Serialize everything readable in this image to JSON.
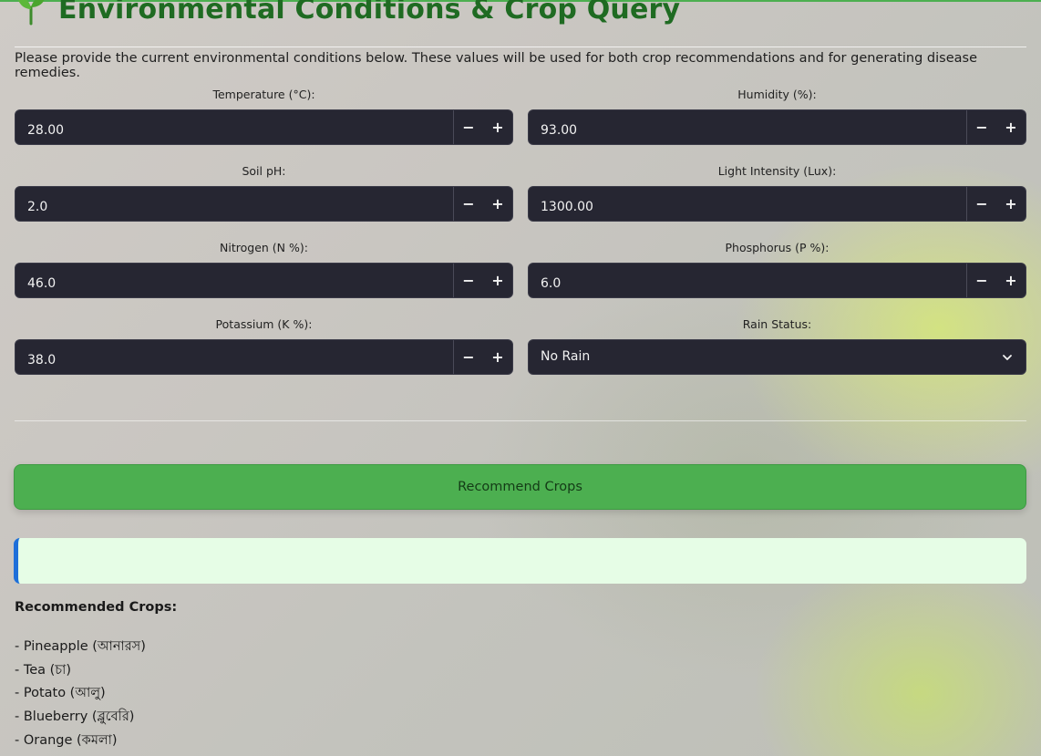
{
  "header": {
    "title": "Environmental Conditions & Crop Query",
    "icon": "sprout-icon"
  },
  "intro_text": "Please provide the current environmental conditions below. These values will be used for both crop recommendations and for generating disease remedies.",
  "fields": {
    "temperature": {
      "label": "Temperature (°C):",
      "value": "28.00"
    },
    "humidity": {
      "label": "Humidity (%):",
      "value": "93.00"
    },
    "soil_ph": {
      "label": "Soil pH:",
      "value": "2.0"
    },
    "light": {
      "label": "Light Intensity (Lux):",
      "value": "1300.00"
    },
    "nitrogen": {
      "label": "Nitrogen (N %):",
      "value": "46.0"
    },
    "phosphorus": {
      "label": "Phosphorus (P %):",
      "value": "6.0"
    },
    "potassium": {
      "label": "Potassium (K %):",
      "value": "38.0"
    },
    "rain": {
      "label": "Rain Status:",
      "value": "No Rain"
    }
  },
  "stepper": {
    "minus": "−",
    "plus": "+"
  },
  "recommend_button": "Recommend Crops",
  "results": {
    "heading": "Recommended Crops:",
    "crops": [
      "- Pineapple (আনারস)",
      "- Tea (চা)",
      "- Potato (আলু)",
      "- Blueberry (ব্লুবেরি)",
      "- Orange (কমলা)"
    ]
  },
  "colors": {
    "accent_green": "#4caf50",
    "title_green": "#1f6b22",
    "input_bg": "#262632",
    "result_bg": "#e6fde6",
    "result_border": "#1e6fd9"
  }
}
